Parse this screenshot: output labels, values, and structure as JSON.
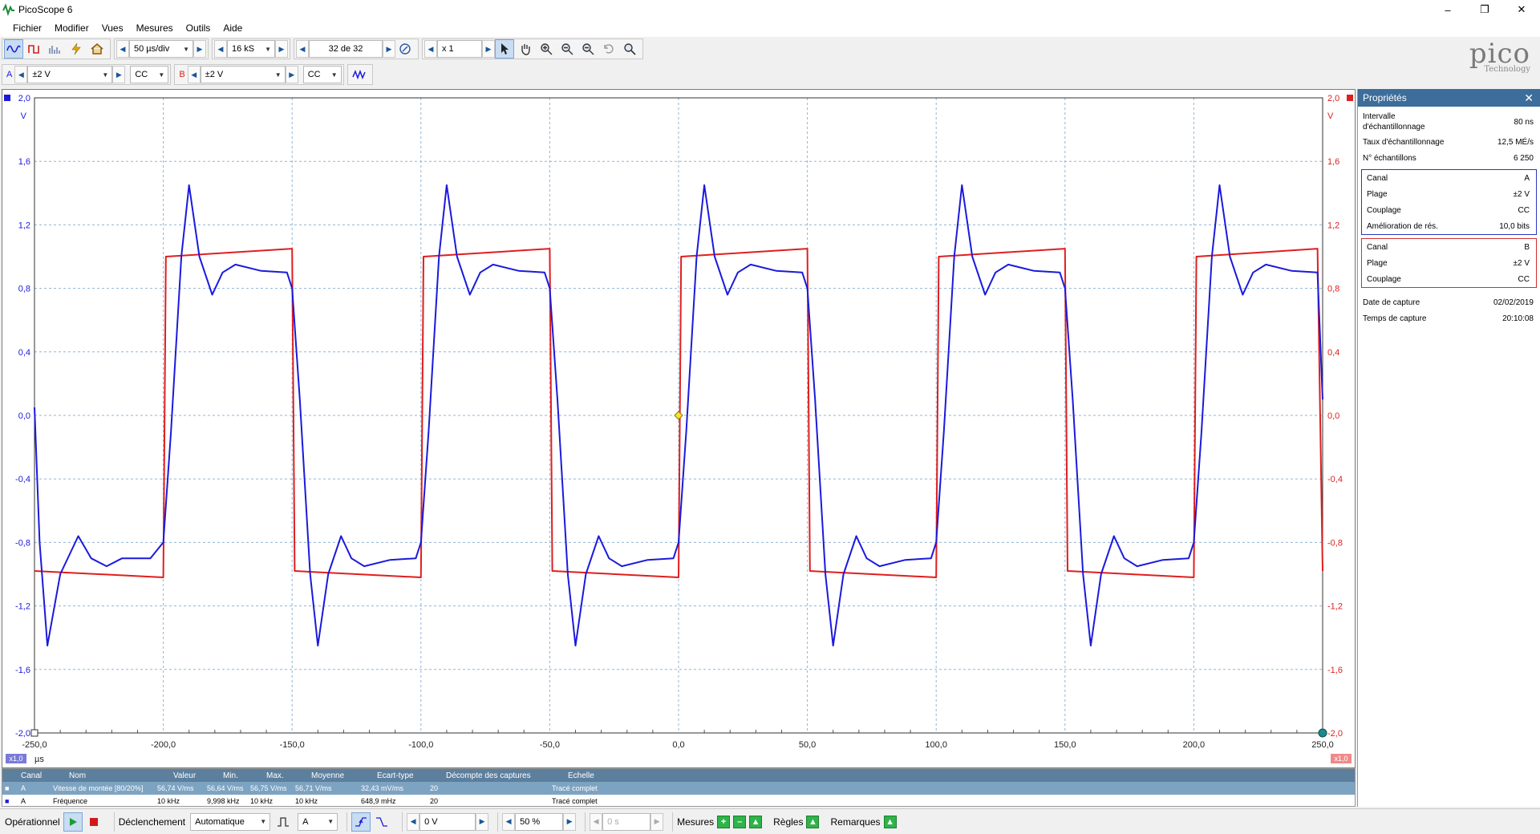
{
  "window": {
    "title": "PicoScope 6",
    "minimize": "–",
    "restore": "❐",
    "close": "✕"
  },
  "menu": [
    "Fichier",
    "Modifier",
    "Vues",
    "Mesures",
    "Outils",
    "Aide"
  ],
  "toolbar": {
    "timebase": "50 µs/div",
    "samples": "16 kS",
    "capture": "32 de 32",
    "zoom": "x 1"
  },
  "channels": {
    "a": {
      "label": "A",
      "range": "±2 V",
      "coupling": "CC"
    },
    "b": {
      "label": "B",
      "range": "±2 V",
      "coupling": "CC"
    }
  },
  "logo": {
    "brand": "pico",
    "sub": "Technology"
  },
  "scope": {
    "y_ticks": [
      "2,0",
      "1,6",
      "1,2",
      "0,8",
      "0,4",
      "0,0",
      "-0,4",
      "-0,8",
      "-1,2",
      "-1,6",
      "-2,0"
    ],
    "y_unit": "V",
    "x_ticks": [
      "-250,0",
      "-200,0",
      "-150,0",
      "-100,0",
      "-50,0",
      "0,0",
      "50,0",
      "100,0",
      "150,0",
      "200,0",
      "250,0"
    ],
    "x_unit": "µs",
    "scale_left": "x1,0",
    "scale_right": "x1,0",
    "colors": {
      "a": "#1a1adc",
      "b": "#e01e1e",
      "grid": "#8fb5d6"
    }
  },
  "chart_data": {
    "type": "line",
    "xlabel": "µs",
    "ylabel": "V",
    "xlim": [
      -250,
      250
    ],
    "ylim": [
      -2,
      2
    ],
    "series": [
      {
        "name": "A",
        "color": "#1a1adc",
        "x": [
          -250,
          -248,
          -245,
          -240,
          -233,
          -228,
          -222,
          -216,
          -205,
          -200,
          -197,
          -193,
          -190,
          -186,
          -181,
          -177,
          -172,
          -162,
          -152,
          -150,
          -147,
          -143,
          -140,
          -136,
          -131,
          -127,
          -122,
          -112,
          -102,
          -100,
          -97,
          -93,
          -90,
          -86,
          -81,
          -77,
          -72,
          -62,
          -52,
          -50,
          -47,
          -43,
          -40,
          -36,
          -31,
          -27,
          -22,
          -12,
          -2,
          0,
          3,
          7,
          10,
          14,
          19,
          23,
          28,
          38,
          48,
          50,
          53,
          57,
          60,
          64,
          69,
          73,
          78,
          88,
          98,
          100,
          103,
          107,
          110,
          114,
          119,
          123,
          128,
          138,
          148,
          150,
          153,
          157,
          160,
          164,
          169,
          173,
          178,
          188,
          198,
          200,
          203,
          207,
          210,
          214,
          219,
          223,
          228,
          238,
          248,
          250
        ],
        "values": [
          0.05,
          -0.8,
          -1.45,
          -1.0,
          -0.76,
          -0.9,
          -0.95,
          -0.9,
          -0.9,
          -0.8,
          -0.1,
          1.0,
          1.45,
          1.0,
          0.76,
          0.9,
          0.95,
          0.91,
          0.9,
          0.8,
          0.1,
          -1.0,
          -1.45,
          -1.0,
          -0.76,
          -0.9,
          -0.95,
          -0.91,
          -0.9,
          -0.8,
          -0.1,
          1.0,
          1.45,
          1.0,
          0.76,
          0.9,
          0.95,
          0.91,
          0.9,
          0.8,
          0.1,
          -1.0,
          -1.45,
          -1.0,
          -0.76,
          -0.9,
          -0.95,
          -0.91,
          -0.9,
          -0.8,
          -0.1,
          1.0,
          1.45,
          1.0,
          0.76,
          0.9,
          0.95,
          0.91,
          0.9,
          0.8,
          0.1,
          -1.0,
          -1.45,
          -1.0,
          -0.76,
          -0.9,
          -0.95,
          -0.91,
          -0.9,
          -0.8,
          -0.1,
          1.0,
          1.45,
          1.0,
          0.76,
          0.9,
          0.95,
          0.91,
          0.9,
          0.8,
          0.1,
          -1.0,
          -1.45,
          -1.0,
          -0.76,
          -0.9,
          -0.95,
          -0.91,
          -0.9,
          -0.8,
          -0.1,
          1.0,
          1.45,
          1.0,
          0.76,
          0.9,
          0.95,
          0.91,
          0.9,
          0.1
        ]
      },
      {
        "name": "B",
        "color": "#e01e1e",
        "x": [
          -250,
          -200,
          -199,
          -150,
          -149,
          -100,
          -99,
          -50,
          -49,
          0,
          1,
          50,
          51,
          100,
          101,
          150,
          151,
          200,
          201,
          248,
          250
        ],
        "values": [
          -0.98,
          -1.02,
          1.0,
          1.05,
          -0.98,
          -1.02,
          1.0,
          1.05,
          -0.98,
          -1.02,
          1.0,
          1.05,
          -0.98,
          -1.02,
          1.0,
          1.05,
          -0.98,
          -1.02,
          1.0,
          1.05,
          -0.98
        ]
      }
    ]
  },
  "properties": {
    "title": "Propriétés",
    "close": "✕",
    "general": [
      {
        "k": "Intervalle d'échantillonnage",
        "v": "80 ns"
      },
      {
        "k": "Taux d'échantillonnage",
        "v": "12,5 MÉ/s"
      },
      {
        "k": "N° échantillons",
        "v": "6 250"
      }
    ],
    "channel_a": [
      {
        "k": "Canal",
        "v": "A"
      },
      {
        "k": "Plage",
        "v": "±2 V"
      },
      {
        "k": "Couplage",
        "v": "CC"
      },
      {
        "k": "Amélioration de rés.",
        "v": "10,0 bits"
      }
    ],
    "channel_b": [
      {
        "k": "Canal",
        "v": "B"
      },
      {
        "k": "Plage",
        "v": "±2 V"
      },
      {
        "k": "Couplage",
        "v": "CC"
      }
    ],
    "capture": [
      {
        "k": "Date de capture",
        "v": "02/02/2019"
      },
      {
        "k": "Temps de capture",
        "v": "20:10:08"
      }
    ]
  },
  "measurements": {
    "headers": [
      "Canal",
      "Nom",
      "Valeur",
      "Min.",
      "Max.",
      "Moyenne",
      "Écart-type",
      "Décompte des captures",
      "Échelle"
    ],
    "rows": [
      [
        "A",
        "Vitesse de montée [80/20%]",
        "56,74 V/ms",
        "56,64 V/ms",
        "56,75 V/ms",
        "56,71 V/ms",
        "32,43 mV/ms",
        "20",
        "Tracé complet"
      ],
      [
        "A",
        "Fréquence",
        "10 kHz",
        "9,998 kHz",
        "10 kHz",
        "10 kHz",
        "648,9 mHz",
        "20",
        "Tracé complet"
      ]
    ]
  },
  "status": {
    "run_label": "Opérationnel",
    "trigger_label": "Déclenchement",
    "trigger_mode": "Automatique",
    "trigger_channel": "A",
    "trigger_level": "0 V",
    "pretrigger": "50 %",
    "delay": "0 s",
    "measures_label": "Mesures",
    "rules_label": "Règles",
    "notes_label": "Remarques"
  }
}
